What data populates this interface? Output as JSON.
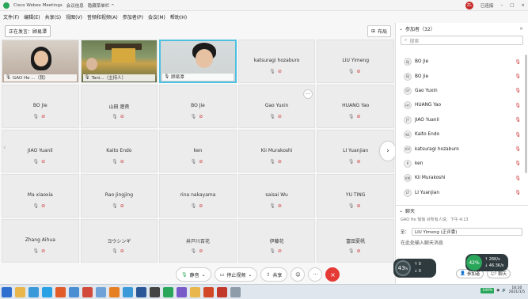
{
  "titlebar": {
    "app_title": "Cisco Webex Meetings",
    "meeting_info": "会议信息",
    "hide_toolbar": "隐藏菜单栏 ^",
    "user_initials": "ZL",
    "user_label": "已连接"
  },
  "menu": [
    "文件(F)",
    "编辑(E)",
    "共享(S)",
    "视图(V)",
    "音频和视频(A)",
    "参加者(P)",
    "会议(M)",
    "帮助(H)"
  ],
  "speaker": {
    "label": "正在发言：顾易潭"
  },
  "layout_button": "布局",
  "tiles": [
    {
      "name": "GAO He ...（我）",
      "video": "v1"
    },
    {
      "name": "Tani...（主持人）",
      "video": "v2"
    },
    {
      "name": "顾易潭",
      "video": "v3"
    },
    {
      "name": "katsuragi hozaburo"
    },
    {
      "name": "LIU Yimeng"
    },
    {
      "name": "BO Jie"
    },
    {
      "name": "山田 遼貴"
    },
    {
      "name": "BO Jie"
    },
    {
      "name": "Gao Yuxin"
    },
    {
      "name": "HUANG Yao"
    },
    {
      "name": "JIAO Yuanli"
    },
    {
      "name": "Kaito Endo"
    },
    {
      "name": "ken"
    },
    {
      "name": "Kii Murakoshi"
    },
    {
      "name": "LI Yuanjian"
    },
    {
      "name": "Ma xiaoxia"
    },
    {
      "name": "Rao Jingjing"
    },
    {
      "name": "rina nakayama"
    },
    {
      "name": "saisai Wu"
    },
    {
      "name": "YU TING"
    },
    {
      "name": "Zhang Aihua"
    },
    {
      "name": "ヨウシンギ"
    },
    {
      "name": "井戸川百花"
    },
    {
      "name": "伊藤花"
    },
    {
      "name": "富田夏帆"
    }
  ],
  "toolbar": {
    "mute": "静音",
    "stop_video": "停止视频",
    "share": "共享",
    "more": "···"
  },
  "participants_panel": {
    "title": "参加者（32）",
    "search_placeholder": "搜索",
    "items": [
      {
        "initials": "BJ",
        "name": "BO Jie"
      },
      {
        "initials": "BJ",
        "name": "BO Jie"
      },
      {
        "initials": "GY",
        "name": "Gao Yuxin"
      },
      {
        "initials": "HY",
        "name": "HUANG Yao"
      },
      {
        "initials": "JY",
        "name": "JIAO Yuanli"
      },
      {
        "initials": "KE",
        "name": "Kaito Endo"
      },
      {
        "initials": "KH",
        "name": "katsuragi hozaburo"
      },
      {
        "initials": "K",
        "name": "ken"
      },
      {
        "initials": "KM",
        "name": "Kii Murakoshi"
      },
      {
        "initials": "LY",
        "name": "LI Yuanjian"
      }
    ]
  },
  "chat_panel": {
    "title": "聊天",
    "last_message": "GAO He 悄悄 对所有人说：下午 4:13",
    "to_label": "至：",
    "to_value": "LIU Yimeng (正评委)",
    "input_placeholder": "在此处输入聊天消息",
    "participants_btn": "参加者",
    "chat_btn": "聊天"
  },
  "meters": {
    "left_value": "43",
    "left_unit": "%",
    "up": "0",
    "down": "0",
    "right_value": "42%",
    "right_up": "26K/s",
    "right_down": "46.3K/s"
  },
  "taskbar": {
    "battery": "100%",
    "time": "16:20",
    "date": "2021/1/5"
  },
  "colors": {
    "accent_blue": "#4dbfe0",
    "end_red": "#e53935",
    "brand_green": "#2aa65b"
  }
}
